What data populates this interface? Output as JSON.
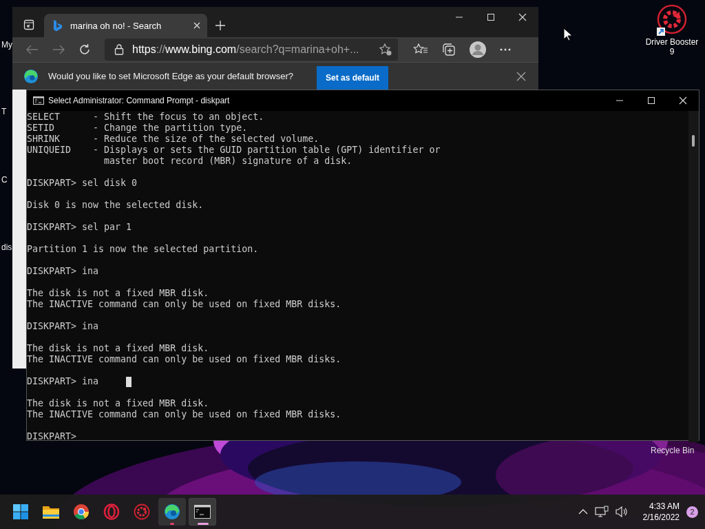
{
  "desktop": {
    "shortcuts": [
      {
        "label": "Driver Booster 9",
        "kind": "booster"
      }
    ],
    "recycle_bin": {
      "label": "Recycle Bin"
    },
    "cut_labels": [
      "My",
      "T",
      "C",
      "dis"
    ]
  },
  "browser": {
    "tabs": [
      {
        "title": "marina oh no! - Search",
        "selected": true
      }
    ],
    "address": {
      "scheme": "https",
      "separator": "://",
      "host": "www.bing.com",
      "path": "/search?q=marina+oh+..."
    },
    "infobar": {
      "message": "Would you like to set Microsoft Edge as your default browser?",
      "button": "Set as default"
    }
  },
  "console": {
    "title": "Select Administrator: Command Prompt - diskpart",
    "blocks": [
      {
        "lines": [
          "SELECT      - Shift the focus to an object.",
          "SETID       - Change the partition type.",
          "SHRINK      - Reduce the size of the selected volume.",
          "UNIQUEID    - Displays or sets the GUID partition table (GPT) identifier or",
          "              master boot record (MBR) signature of a disk."
        ],
        "cursor": false
      },
      {
        "lines": [
          "DISKPART> sel disk 0"
        ],
        "cursor": false
      },
      {
        "lines": [
          "Disk 0 is now the selected disk."
        ],
        "cursor": false
      },
      {
        "lines": [
          "DISKPART> sel par 1"
        ],
        "cursor": false
      },
      {
        "lines": [
          "Partition 1 is now the selected partition."
        ],
        "cursor": false
      },
      {
        "lines": [
          "DISKPART> ina"
        ],
        "cursor": false
      },
      {
        "lines": [
          "The disk is not a fixed MBR disk.",
          "The INACTIVE command can only be used on fixed MBR disks."
        ],
        "cursor": false
      },
      {
        "lines": [
          "DISKPART> ina"
        ],
        "cursor": false
      },
      {
        "lines": [
          "The disk is not a fixed MBR disk.",
          "The INACTIVE command can only be used on fixed MBR disks."
        ],
        "cursor": false
      },
      {
        "lines": [
          "DISKPART> ina"
        ],
        "cursor": true
      },
      {
        "lines": [
          "The disk is not a fixed MBR disk.",
          "The INACTIVE command can only be used on fixed MBR disks."
        ],
        "cursor": false
      },
      {
        "lines": [
          "DISKPART>"
        ],
        "cursor": false
      }
    ]
  },
  "taskbar": {
    "apps": [
      {
        "kind": "start",
        "running": false,
        "focused": false
      },
      {
        "kind": "folder",
        "running": false,
        "focused": false
      },
      {
        "kind": "chrome",
        "running": false,
        "focused": false
      },
      {
        "kind": "opera",
        "running": false,
        "focused": false
      },
      {
        "kind": "booster",
        "running": false,
        "focused": false
      },
      {
        "kind": "edge",
        "running": true,
        "focused": false
      },
      {
        "kind": "terminal",
        "running": true,
        "focused": true
      }
    ],
    "time": "4:33 AM",
    "date": "2/16/2022",
    "notifications": "2"
  }
}
